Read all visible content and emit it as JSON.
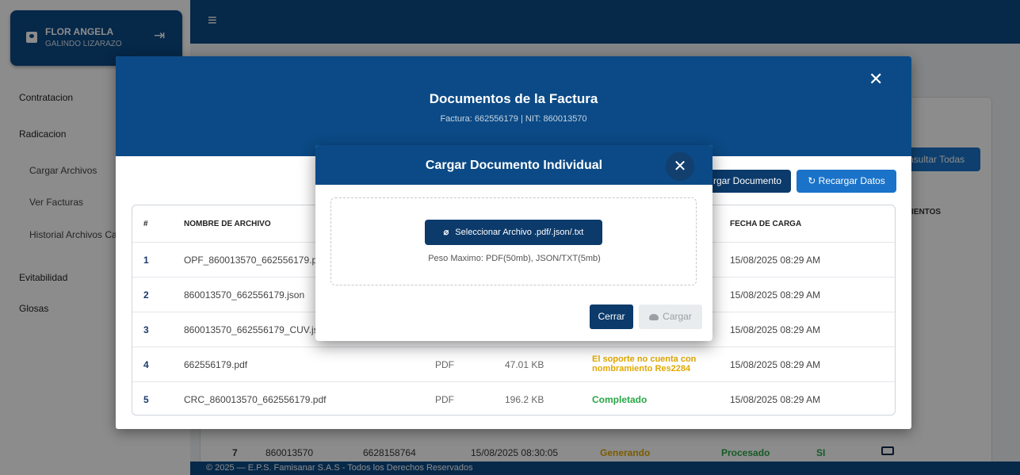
{
  "user": {
    "first_name": "FLOR ANGELA",
    "last_name": "GALINDO LIZARAZO"
  },
  "sidebar": {
    "items": [
      {
        "label": "Contratacion"
      },
      {
        "label": "Radicacion"
      },
      {
        "label": "Cargar Archivos"
      },
      {
        "label": "Ver Facturas"
      },
      {
        "label": "Historial Archivos Ca"
      },
      {
        "label": "Evitabilidad"
      },
      {
        "label": "Glosas"
      }
    ]
  },
  "background": {
    "consultar_label": "nsultar Todas",
    "column_header": "IENTOS",
    "row7": {
      "num": "7",
      "nit": "860013570",
      "factura": "6628158764",
      "date": "15/08/2025 08:30:05",
      "state1": "Generando",
      "state2": "Procesado",
      "flag": "SI"
    },
    "footer": "© 2025 — E.P.S. Famisanar S.A.S - Todos los Derechos Reservados"
  },
  "outer_modal": {
    "title": "Documentos de la Factura",
    "subtitle": "Factura: 662556179 | NIT: 860013570",
    "agregar_label": "rgar Documento",
    "recargar_label": "Recargar Datos",
    "table": {
      "headers": {
        "num": "#",
        "name": "NOMBRE DE ARCHIVO",
        "date": "FECHA DE CARGA"
      },
      "rows": [
        {
          "num": "1",
          "name": "OPF_860013570_662556179.pc",
          "type": "",
          "size": "",
          "state": "",
          "date": "15/08/2025 08:29 AM"
        },
        {
          "num": "2",
          "name": "860013570_662556179.json",
          "type": "",
          "size": "",
          "state": "",
          "date": "15/08/2025 08:29 AM"
        },
        {
          "num": "3",
          "name": "860013570_662556179_CUV.jsı",
          "type": "",
          "size": "",
          "state": "",
          "date": "15/08/2025 08:29 AM"
        },
        {
          "num": "4",
          "name": "662556179.pdf",
          "type": "PDF",
          "size": "47.01 KB",
          "state": "El soporte no cuenta con nombramiento Res2284",
          "date": "15/08/2025 08:29 AM"
        },
        {
          "num": "5",
          "name": "CRC_860013570_662556179.pdf",
          "type": "PDF",
          "size": "196.2 KB",
          "state": "Completado",
          "date": "15/08/2025 08:29 AM"
        }
      ]
    }
  },
  "inner_modal": {
    "title": "Cargar Documento Individual",
    "select_label": "Seleccionar Archivo .pdf/.json/.txt",
    "max_size": "Peso Maximo: PDF(50mb), JSON/TXT(5mb)",
    "cerrar_label": "Cerrar",
    "cargar_label": "Cargar"
  },
  "colors": {
    "primary": "#0b4a86",
    "accent": "#1a73c9",
    "warning": "#e0a800",
    "success": "#28a745"
  }
}
